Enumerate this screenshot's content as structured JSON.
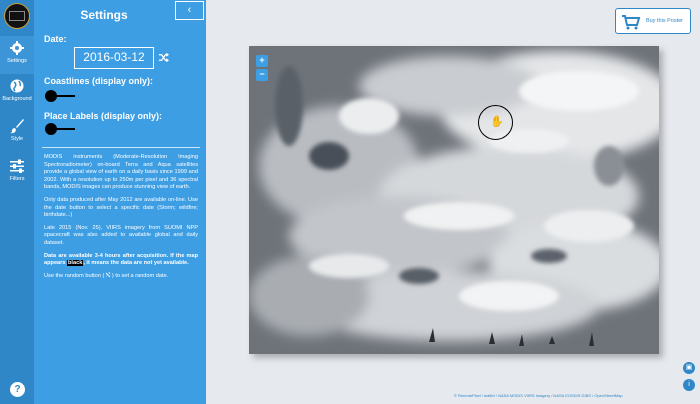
{
  "rail": {
    "items": [
      {
        "label": "Settings",
        "icon": "gear-icon"
      },
      {
        "label": "Background",
        "icon": "globe-icon"
      },
      {
        "label": "Style",
        "icon": "brush-icon"
      },
      {
        "label": "Filters",
        "icon": "sliders-icon"
      }
    ],
    "help_label": "?"
  },
  "panel": {
    "title": "Settings",
    "collapse_label": "‹",
    "date_label": "Date:",
    "date_value": "2016-03-12",
    "coastlines_label": "Coastlines (display only):",
    "place_labels_label": "Place Labels (display only):",
    "description": {
      "p1": "MODIS instruments (Moderate-Resolution Imaging Spectroradiometer) on-board Terra and Aqua satellites provide a global view of earth on a daily basis since 1999 and 2002. With a resolution up to 250m per pixel and 36 spectral bands, MODIS images can produce stunning view of earth.",
      "p2": "Only data produced after May 2012 are available on-line. Use the date button to select a specific date (Storm; wildfire; birthdate...)",
      "p3": "Late 2015 (Nov. 25), VIIRS imagery from SUOMI NPP spacecraft was also added to available global and daily dataset.",
      "p4_before": "Data are available 3-4 hours after acquisition. If the map appears ",
      "p4_black": "black",
      "p4_after": ", it means the data are not yet available.",
      "p5": "Use the random button ( ⤭ ) to set a random date."
    }
  },
  "main": {
    "buy_label": "Buy this Poster",
    "zoom_in": "+",
    "zoom_out": "−",
    "attribution": "© RemotePixel  /  leaflet  /  NASA MODIS VIIRS Imagery  /  NASA EOSDIS GIBS  /  OpenStreetMap"
  },
  "colors": {
    "rail": "#2f87c8",
    "panel": "#3d9ee4",
    "main_bg": "#e6e9ee",
    "accent": "#2f87c8"
  }
}
